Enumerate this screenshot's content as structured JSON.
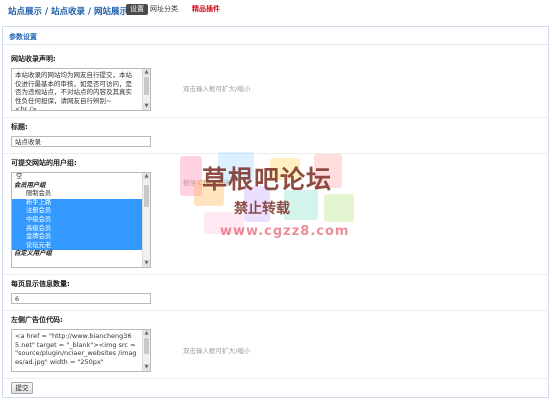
{
  "header": {
    "breadcrumb": "站点展示 / 站点收录 / 网站展示",
    "tabs": [
      {
        "label": "设置",
        "active": true
      },
      {
        "label": "网址分类",
        "active": false
      },
      {
        "label": "精品插件",
        "active": false,
        "highlight": "#d0101a"
      }
    ]
  },
  "panel": {
    "title": "参数设置",
    "fields": {
      "notice": {
        "label": "网站收录声明:",
        "value": "本站收录的网站均为网友自行提交，本站仅进行最基本的审核，如是否可访问，是否为违规站点，不对站点的内容及其真实性负任何担保，请网友自行辨别~\n<br />",
        "tip": "双击输入框可扩大/缩小"
      },
      "title": {
        "label": "标题:",
        "value": "站点收录"
      },
      "usergroups": {
        "label": "可提交网站的用户组:",
        "tip": "按住 CTRL 多选",
        "options": [
          {
            "label": "空",
            "type": "plain",
            "selected": false
          },
          {
            "label": "会员用户组",
            "type": "group",
            "selected": false
          },
          {
            "label": "限制会员",
            "type": "sub",
            "selected": false
          },
          {
            "label": "新手上路",
            "type": "sub",
            "selected": true
          },
          {
            "label": "注册会员",
            "type": "sub",
            "selected": true
          },
          {
            "label": "中级会员",
            "type": "sub",
            "selected": true
          },
          {
            "label": "高级会员",
            "type": "sub",
            "selected": true
          },
          {
            "label": "金牌会员",
            "type": "sub",
            "selected": true
          },
          {
            "label": "论坛元老",
            "type": "sub",
            "selected": true
          },
          {
            "label": "自定义用户组",
            "type": "group",
            "selected": false
          }
        ]
      },
      "perpage": {
        "label": "每页显示信息数量:",
        "value": "6"
      },
      "leftad": {
        "label": "左侧广告位代码:",
        "value": "<a href = \"http://www.biancheng365.net\" target = \"_blank\"><img src = \"source/plugin/nciaer_websites /images/ad.jpg\" width = \"250px\"",
        "tip": "双击输入框可扩大/缩小"
      }
    },
    "submit_label": "提交"
  },
  "watermark": {
    "title": "草根吧论坛",
    "subtitle": "禁止转载",
    "url": "www.cgzz8.com"
  }
}
